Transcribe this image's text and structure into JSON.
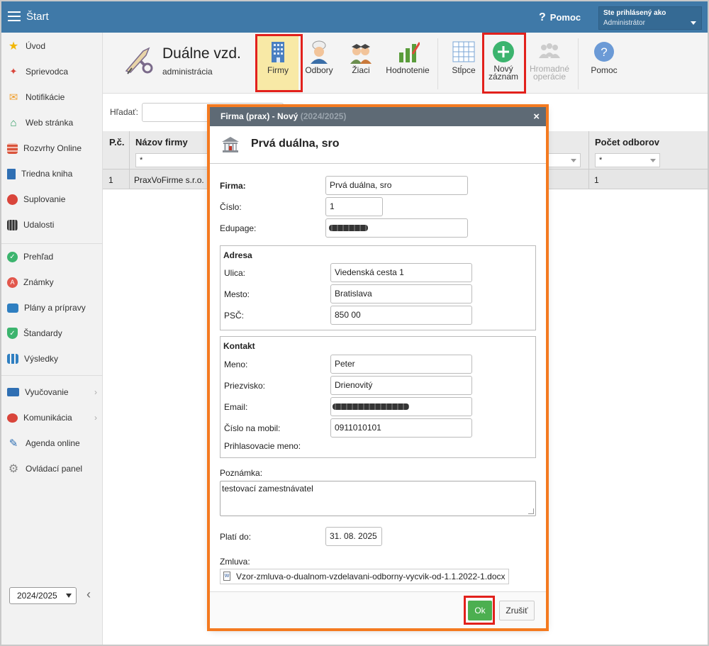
{
  "topbar": {
    "title": "Štart",
    "help": "Pomoc",
    "user_line1": "Ste prihlásený ako",
    "user_line2": "Administrátor"
  },
  "sidebar": {
    "items": [
      {
        "label": "Úvod",
        "icon": "star-icon"
      },
      {
        "label": "Sprievodca",
        "icon": "wand-icon"
      },
      {
        "label": "Notifikácie",
        "icon": "envelope-icon"
      },
      {
        "label": "Web stránka",
        "icon": "home-icon"
      },
      {
        "label": "Rozvrhy Online",
        "icon": "timetable-icon"
      },
      {
        "label": "Triedna kniha",
        "icon": "book-icon"
      },
      {
        "label": "Suplovanie",
        "icon": "substitution-icon"
      },
      {
        "label": "Udalosti",
        "icon": "calendar-icon"
      },
      {
        "label": "Prehľad",
        "icon": "check-circle-icon"
      },
      {
        "label": "Známky",
        "icon": "grades-icon"
      },
      {
        "label": "Plány a prípravy",
        "icon": "briefcase-icon"
      },
      {
        "label": "Štandardy",
        "icon": "shield-check-icon"
      },
      {
        "label": "Výsledky",
        "icon": "bar-chart-icon"
      },
      {
        "label": "Vyučovanie",
        "icon": "open-book-icon"
      },
      {
        "label": "Komunikácia",
        "icon": "chat-icon"
      },
      {
        "label": "Agenda online",
        "icon": "pen-icon"
      },
      {
        "label": "Ovládací panel",
        "icon": "gear-icon"
      }
    ],
    "year": "2024/2025"
  },
  "module": {
    "title": "Duálne vzd.",
    "subtitle": "administrácia"
  },
  "toolbar": {
    "firmy": "Firmy",
    "odbory": "Odbory",
    "ziaci": "Žiaci",
    "hodnotenie": "Hodnotenie",
    "stlpce": "Stĺpce",
    "novy_line1": "Nový",
    "novy_line2": "záznam",
    "hromadne_line1": "Hromadné",
    "hromadne_line2": "operácie",
    "pomoc": "Pomoc"
  },
  "list": {
    "search_label": "Hľadať:",
    "col_pc": "P.č.",
    "col_name": "Názov firmy",
    "col_count": "Počet odborov",
    "filter": "*",
    "rows": [
      {
        "pc": "1",
        "name": "PraxVoFirme s.r.o.",
        "count": "1"
      }
    ]
  },
  "dialog": {
    "title_main": "Firma (prax) - Nový",
    "title_year": "(2024/2025)",
    "close": "×",
    "heading": "Prvá duálna, sro",
    "firma_label": "Firma:",
    "firma_value": "Prvá duálna, sro",
    "cislo_label": "Číslo:",
    "cislo_value": "1",
    "edupage_label": "Edupage:",
    "adresa_legend": "Adresa",
    "ulica_label": "Ulica:",
    "ulica_value": "Viedenská cesta 1",
    "mesto_label": "Mesto:",
    "mesto_value": "Bratislava",
    "psc_label": "PSČ:",
    "psc_value": "850 00",
    "kontakt_legend": "Kontakt",
    "meno_label": "Meno:",
    "meno_value": "Peter",
    "priezvisko_label": "Priezvisko:",
    "priezvisko_value": "Drienovitý",
    "email_label": "Email:",
    "mobil_label": "Číslo na mobil:",
    "mobil_value": "0911010101",
    "login_label": "Prihlasovacie meno:",
    "poznamka_label": "Poznámka:",
    "poznamka_value": "testovací zamestnávatel",
    "plati_label": "Platí do:",
    "plati_value": "31. 08. 2025",
    "zmluva_label": "Zmluva:",
    "zmluva_value": "Vzor-zmluva-o-dualnom-vzdelavani-odborny-vycvik-od-1.1.2022-1.docx",
    "ok": "Ok",
    "cancel": "Zrušiť"
  },
  "colors": {
    "topbar": "#3f79a8",
    "dialog_title": "#5e6a75",
    "ok": "#4caf50",
    "highlight": "#e2211c",
    "dialog_outline": "#f47a20",
    "active_tab": "#f8e9a6"
  }
}
